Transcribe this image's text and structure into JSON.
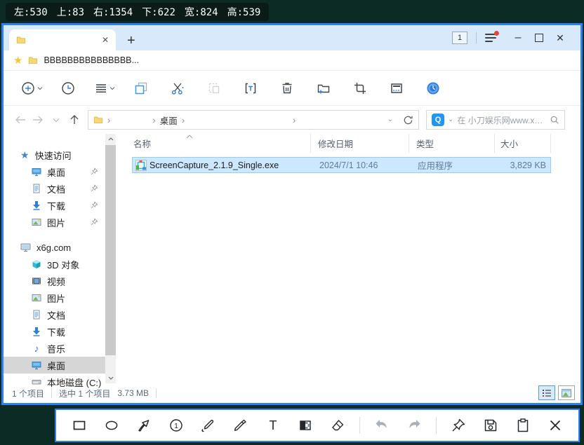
{
  "overlay_badge": {
    "left": "左:530",
    "top": "上:83",
    "right": "右:1354",
    "bottom": "下:622",
    "width": "宽:824",
    "height": "高:539"
  },
  "tab_bar": {
    "tab_count": "1"
  },
  "favorites_bar": {
    "pinned_folder": "BBBBBBBBBBBBBBB..."
  },
  "toolbar": {
    "buttons": [
      {
        "name": "new-item",
        "icon": "circle-plus",
        "has_dropdown": true
      },
      {
        "name": "recent",
        "icon": "clock"
      },
      {
        "name": "sort-view",
        "icon": "menu-lines",
        "has_dropdown": true
      },
      {
        "name": "copy",
        "icon": "copy"
      },
      {
        "name": "cut",
        "icon": "scissors"
      },
      {
        "name": "paste",
        "icon": "paste",
        "disabled": true
      },
      {
        "name": "rename",
        "icon": "bracket-t"
      },
      {
        "name": "delete",
        "icon": "trash"
      },
      {
        "name": "new-folder",
        "icon": "folder-plus"
      },
      {
        "name": "select",
        "icon": "crop"
      },
      {
        "name": "details-pane",
        "icon": "panel"
      },
      {
        "name": "app-logo",
        "icon": "blue-orb"
      }
    ]
  },
  "address_bar": {
    "breadcrumb_visible": "桌面",
    "search_placeholder": "在 小刀娱乐网www.x6...",
    "search_icon_label": "Q"
  },
  "columns": {
    "name": "名称",
    "modified": "修改日期",
    "type": "类型",
    "size": "大小"
  },
  "files": [
    {
      "name": "ScreenCapture_2.1.9_Single.exe",
      "modified": "2024/7/1 10:46",
      "type": "应用程序",
      "size": "3,829 KB",
      "selected": true
    }
  ],
  "sidebar": {
    "quick_access": {
      "label": "快速访问",
      "items": [
        {
          "label": "桌面",
          "icon": "desktop",
          "pinned": true
        },
        {
          "label": "文档",
          "icon": "document",
          "pinned": true
        },
        {
          "label": "下载",
          "icon": "download-arrow",
          "pinned": true
        },
        {
          "label": "图片",
          "icon": "picture",
          "pinned": true
        }
      ]
    },
    "this_pc": {
      "label": "x6g.com",
      "icon": "computer",
      "items": [
        {
          "label": "3D 对象",
          "icon": "cube"
        },
        {
          "label": "视频",
          "icon": "film"
        },
        {
          "label": "图片",
          "icon": "picture"
        },
        {
          "label": "文档",
          "icon": "document"
        },
        {
          "label": "下载",
          "icon": "download-arrow"
        },
        {
          "label": "音乐",
          "icon": "music-note"
        },
        {
          "label": "桌面",
          "icon": "desktop",
          "selected": true
        },
        {
          "label": "本地磁盘 (C:)",
          "icon": "hard-disk"
        }
      ]
    }
  },
  "status_bar": {
    "item_count": "1 个项目",
    "selected_count": "选中 1 个项目",
    "selected_size": "3.73 MB"
  },
  "capture_toolbar": {
    "tools": [
      {
        "name": "rectangle"
      },
      {
        "name": "ellipse"
      },
      {
        "name": "arrow"
      },
      {
        "name": "number-badge"
      },
      {
        "name": "pen"
      },
      {
        "name": "marker"
      },
      {
        "name": "text"
      },
      {
        "name": "mosaic"
      },
      {
        "name": "eraser"
      },
      {
        "name": "undo",
        "disabled": true
      },
      {
        "name": "redo",
        "disabled": true
      },
      {
        "name": "pin"
      },
      {
        "name": "save"
      },
      {
        "name": "clipboard"
      },
      {
        "name": "close"
      }
    ],
    "number_label": "1",
    "text_label": "T"
  },
  "icons": {
    "close": "✕",
    "minimize": "–",
    "new_tab": "+",
    "chevron_right": "›",
    "chevron_down": "⌄",
    "star": "★",
    "quick_access_star": "★",
    "music_note": "♪"
  },
  "colors": {
    "accent_border": "#2f7ff4",
    "tab_bar_bg": "#d8e9fb",
    "selection_bg": "#cce8ff",
    "selection_border": "#99ccf0",
    "overlay_bg": "#0b2b24",
    "badge_bg": "#0b1b17",
    "search_icon_bg": "#2196f3",
    "notification_dot": "#e8443a"
  }
}
